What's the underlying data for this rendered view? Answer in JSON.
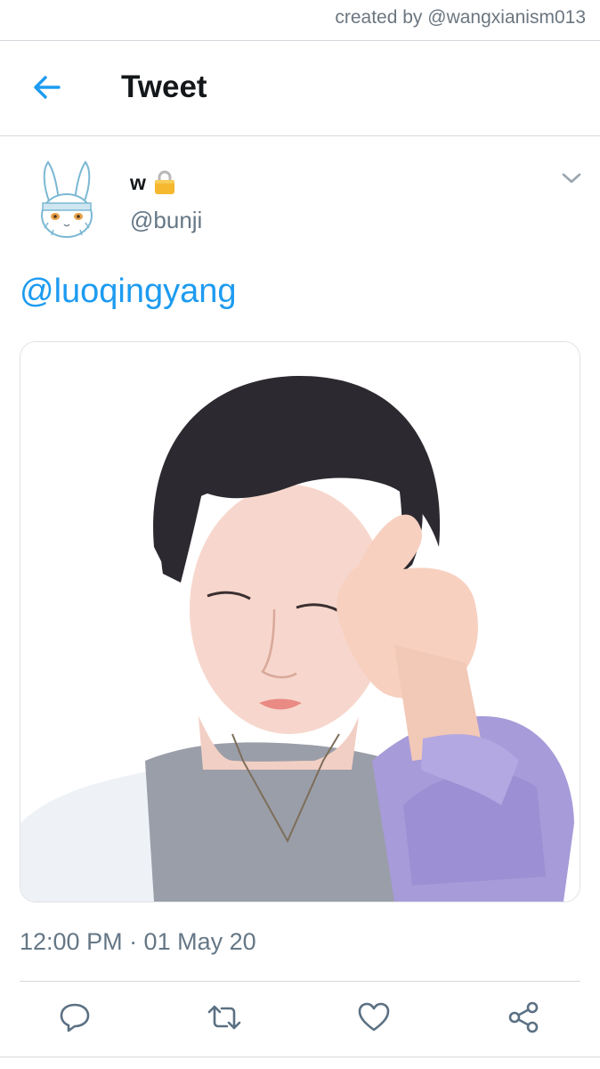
{
  "watermark": "created by @wangxianism013",
  "header": {
    "title": "Tweet",
    "back_icon": "arrow-left-icon"
  },
  "tweet": {
    "display_name": "w",
    "protected_icon": "lock-icon",
    "handle": "@bunji",
    "mention": "@luoqingyang",
    "timestamp": "12:00 PM · 01 May 20",
    "media_description": "photo"
  },
  "actions": [
    "reply-icon",
    "retweet-icon",
    "like-icon",
    "share-icon"
  ],
  "colors": {
    "accent": "#1d9bf0",
    "text": "#14171a",
    "muted": "#657786",
    "divider": "#d5d9dd"
  }
}
